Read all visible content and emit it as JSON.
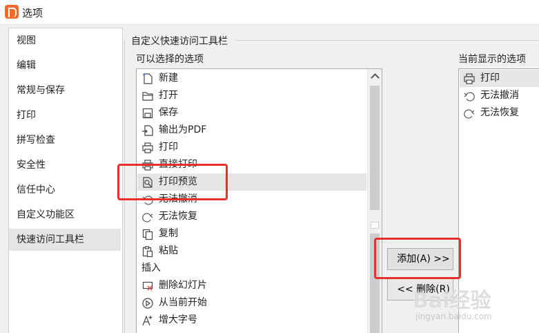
{
  "window": {
    "title": "选项",
    "brand_color": "#f26a2a"
  },
  "sidebar": {
    "items": [
      {
        "label": "视图",
        "icon": ""
      },
      {
        "label": "编辑"
      },
      {
        "label": "常规与保存"
      },
      {
        "label": "打印"
      },
      {
        "label": "拼写检查"
      },
      {
        "label": "安全性"
      },
      {
        "label": "信任中心"
      },
      {
        "label": "自定义功能区"
      },
      {
        "label": "快速访问工具栏",
        "selected": true
      }
    ]
  },
  "main": {
    "group_title": "自定义快速访问工具栏",
    "available_label": "可以选择的选项",
    "current_label": "当前显示的选项",
    "available_items": [
      {
        "label": "新建",
        "icon": "new-icon"
      },
      {
        "label": "打开",
        "icon": "folder-open-icon"
      },
      {
        "label": "保存",
        "icon": "save-icon"
      },
      {
        "label": "输出为PDF",
        "icon": "export-pdf-icon"
      },
      {
        "label": "打印",
        "icon": "printer-icon"
      },
      {
        "label": "直接打印",
        "icon": "direct-print-icon"
      },
      {
        "label": "打印预览",
        "icon": "print-preview-icon",
        "selected": true
      },
      {
        "label": "无法撤消",
        "icon": "undo-icon"
      },
      {
        "label": "无法恢复",
        "icon": "redo-icon"
      },
      {
        "label": "复制",
        "icon": "copy-icon"
      },
      {
        "label": "粘贴",
        "icon": "paste-icon"
      },
      {
        "label": "插入",
        "header": true
      },
      {
        "label": "删除幻灯片",
        "icon": "delete-slide-icon"
      },
      {
        "label": "从当前开始",
        "icon": "play-from-current-icon"
      },
      {
        "label": "增大字号",
        "icon": "increase-font-icon"
      }
    ],
    "current_items": [
      {
        "label": "打印",
        "icon": "printer-icon",
        "selected": true
      },
      {
        "label": "无法撤消",
        "icon": "undo-icon"
      },
      {
        "label": "无法恢复",
        "icon": "redo-icon"
      }
    ],
    "add_button": "添加(A) >>",
    "remove_button": "<< 删除(R)"
  },
  "watermark": {
    "text": "Bai经验",
    "url": "jingyan.baidu.com"
  },
  "colors": {
    "highlight": "#e8302a",
    "selection": "#e6e6e6"
  }
}
